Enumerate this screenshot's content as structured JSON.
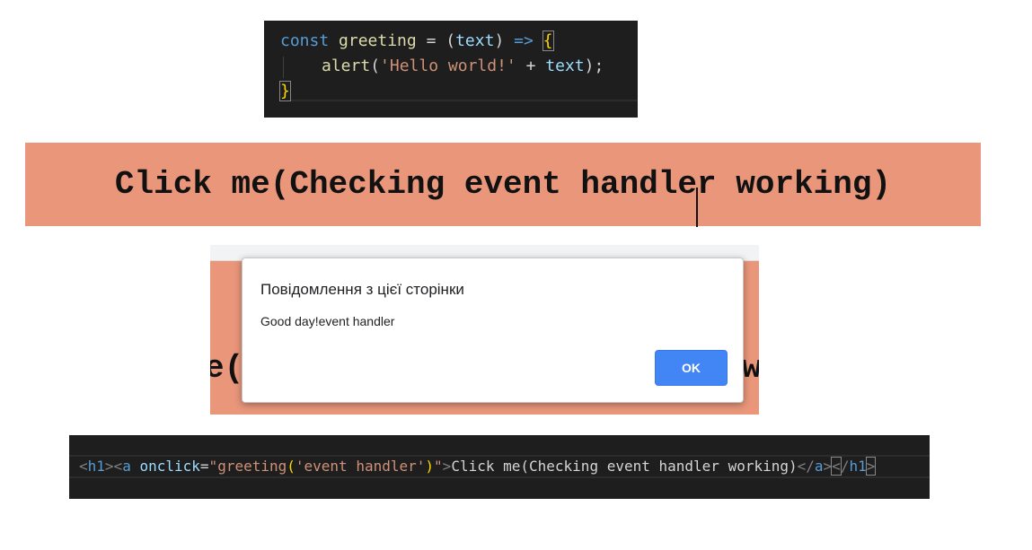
{
  "code_js": {
    "line1": {
      "keyword": "const",
      "name": "greeting",
      "equals": " = ",
      "paren_open": "(",
      "param": "text",
      "paren_close": ")",
      "arrow": " => ",
      "brace_open": "{"
    },
    "line2": {
      "fn": "alert",
      "paren_open": "(",
      "string": "'Hello world!'",
      "plus": " + ",
      "var": "text",
      "paren_close": ")",
      "semicolon": ";"
    },
    "line3": {
      "brace_close": "}"
    }
  },
  "banner": {
    "text_before_caret": "Click me(Checking event handle",
    "text_after_caret": "r working)"
  },
  "alert_preview": {
    "bg_left_text": "e(",
    "bg_right_text": "w",
    "dialog": {
      "title": "Повідомлення з цієї сторінки",
      "message": "Good day!event handler",
      "ok_label": "OK"
    }
  },
  "code_html": {
    "lt1": "<",
    "h1_open": "h1",
    "gt1": ">",
    "lt2": "<",
    "a_open": "a",
    "space": " ",
    "attr_name": "onclick",
    "equals": "=",
    "attr_quote_open": "\"",
    "attr_value_fn": "greeting",
    "attr_value_paren_open": "(",
    "attr_value_arg": "'event handler'",
    "attr_value_paren_close": ")",
    "attr_quote_close": "\"",
    "gt2": ">",
    "text": "Click me(Checking event handler working)",
    "lt3": "</",
    "a_close": "a",
    "gt3": ">",
    "lt4": "<",
    "slash4": "/",
    "h1_close": "h1",
    "gt4": ">"
  },
  "colors": {
    "editor_bg": "#1e1e1e",
    "banner_bg": "#e9967a",
    "ok_button": "#4285f4"
  }
}
